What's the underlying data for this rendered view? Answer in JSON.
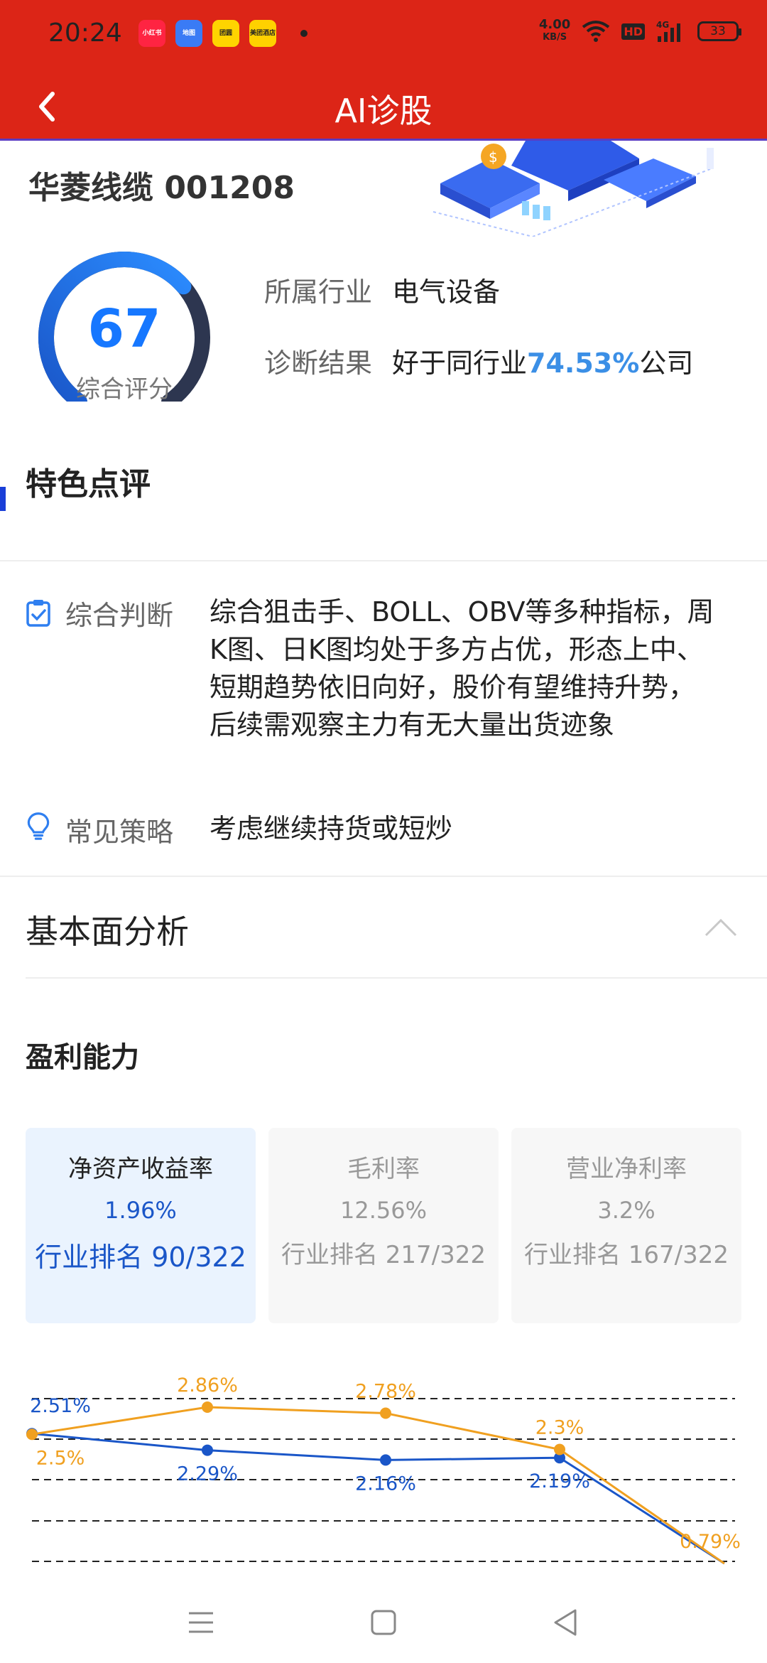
{
  "status_bar": {
    "time": "20:24",
    "apps": [
      {
        "name": "xiaohongshu-icon",
        "label": "小红书",
        "color": "#ff2442"
      },
      {
        "name": "baidu-map-icon",
        "label": "地图",
        "color": "#3a7bf5"
      },
      {
        "name": "tuanyuan-icon",
        "label": "团圆",
        "color": "#ffd400"
      },
      {
        "name": "meituan-hotel-icon",
        "label": "美团酒店",
        "color": "#ffd100"
      }
    ],
    "speed_value": "4.00",
    "speed_unit": "KB/S",
    "hd_label": "HD",
    "network_label": "4G",
    "battery": "33"
  },
  "nav": {
    "title": "AI诊股"
  },
  "stock": {
    "name_code": "华菱线缆 001208",
    "score": "67",
    "score_label": "综合评分",
    "score_fraction": 0.67,
    "industry_key": "所属行业",
    "industry_value": "电气设备",
    "diagnosis_key": "诊断结果",
    "diagnosis_prefix": "好于同行业",
    "diagnosis_percent": "74.53%",
    "diagnosis_suffix": "公司"
  },
  "feature": {
    "title": "特色点评",
    "judgement_key": "综合判断",
    "judgement_value": "综合狙击手、BOLL、OBV等多种指标，周K图、日K图均处于多方占优，形态上中、短期趋势依旧向好，股价有望维持升势，后续需观察主力有无大量出货迹象",
    "strategy_key": "常见策略",
    "strategy_value": "考虑继续持货或短炒"
  },
  "fundamental": {
    "title": "基本面分析",
    "profit_title": "盈利能力",
    "cards": [
      {
        "name": "净资产收益率",
        "value": "1.96%",
        "rank": "行业排名 90/322",
        "active": true
      },
      {
        "name": "毛利率",
        "value": "12.56%",
        "rank": "行业排名 217/322",
        "active": false
      },
      {
        "name": "营业净利率",
        "value": "3.2%",
        "rank": "行业排名 167/322",
        "active": false
      }
    ]
  },
  "chart_data": {
    "type": "line",
    "series": [
      {
        "color": "#1a56c8",
        "values": [
          2.51,
          2.29,
          2.16,
          2.19,
          0.79
        ],
        "labels": [
          "2.51%",
          "2.29%",
          "2.16%",
          "2.19%",
          ""
        ]
      },
      {
        "color": "#f0a020",
        "values": [
          2.5,
          2.86,
          2.78,
          2.3,
          0.79
        ],
        "labels": [
          "2.5%",
          "2.86%",
          "2.78%",
          "2.3%",
          "0.79%"
        ]
      }
    ],
    "grid": "dashed-horizontal"
  },
  "colors": {
    "brand_red": "#dc2517",
    "accent_blue": "#1677ff",
    "highlight_blue": "#3b8fe6"
  }
}
